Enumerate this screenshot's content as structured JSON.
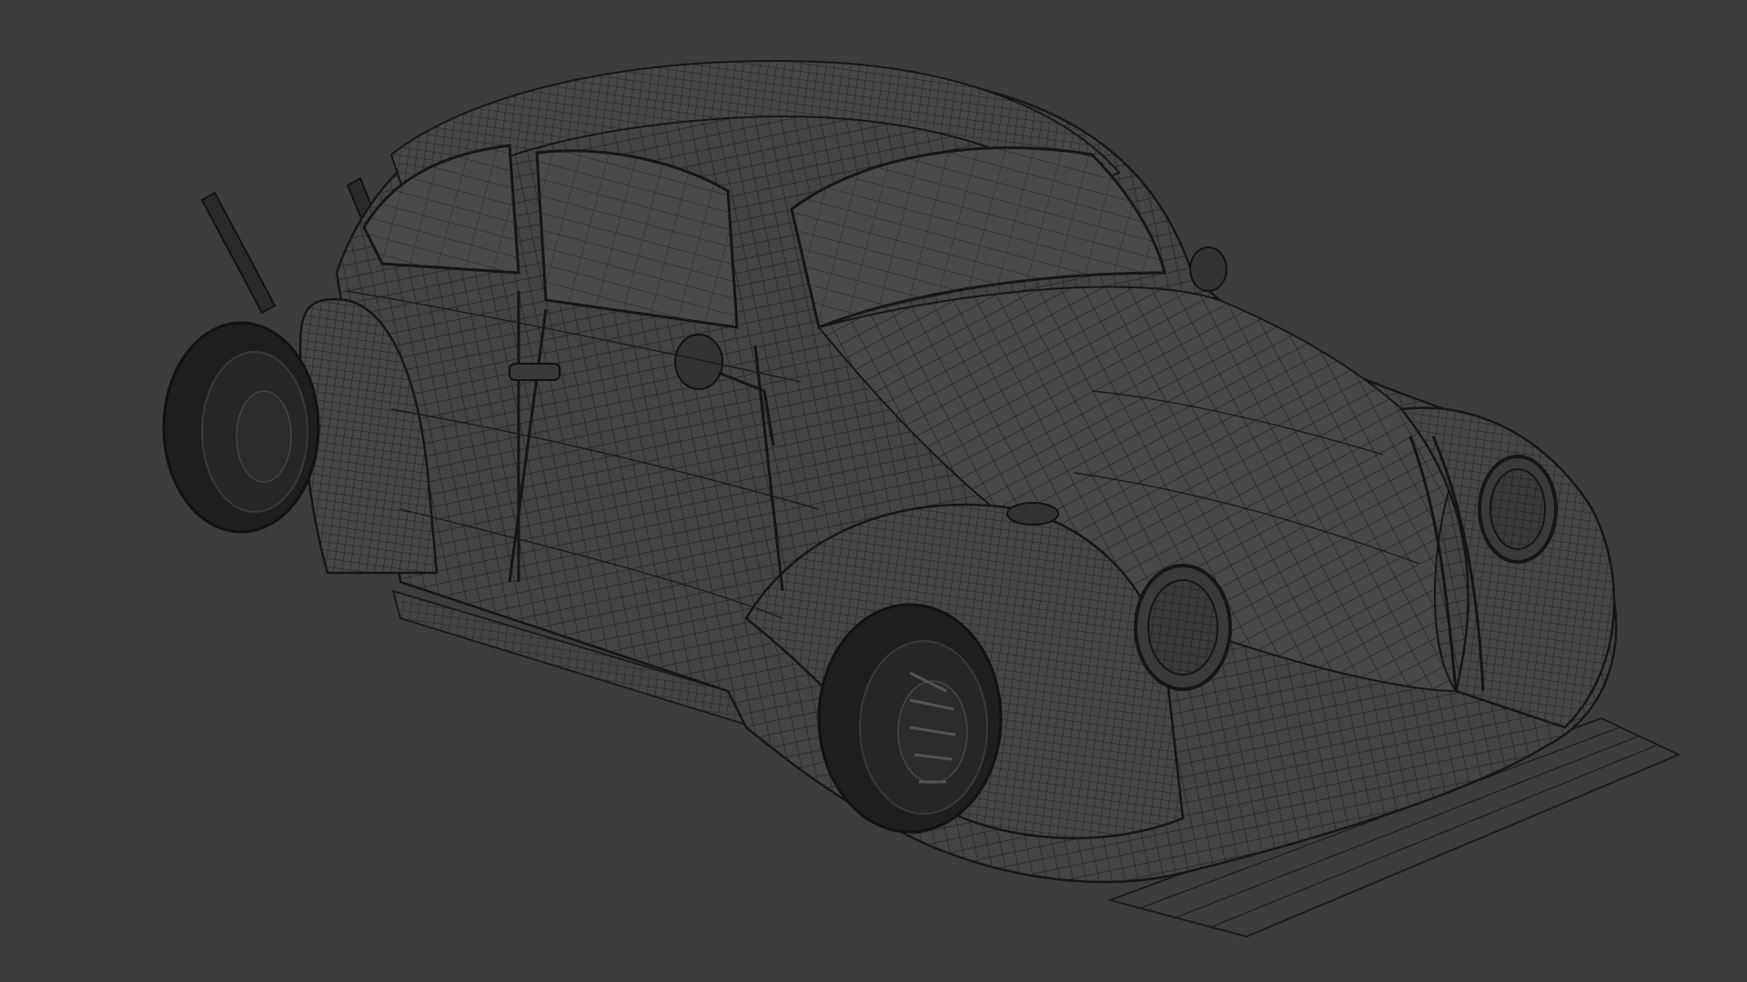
{
  "viewport": {
    "background_color": "#3d3d3d",
    "shading_mode": "wireframe",
    "subject": "car-3d-model",
    "colors": {
      "wire": "#1a1a1a",
      "body_fill": "#454545",
      "glass_fill": "#4a4a4a",
      "tire_fill": "#1e1e1e",
      "rim_fill": "#2c2c2c",
      "highlight_wire": "#5a5a5a"
    }
  }
}
